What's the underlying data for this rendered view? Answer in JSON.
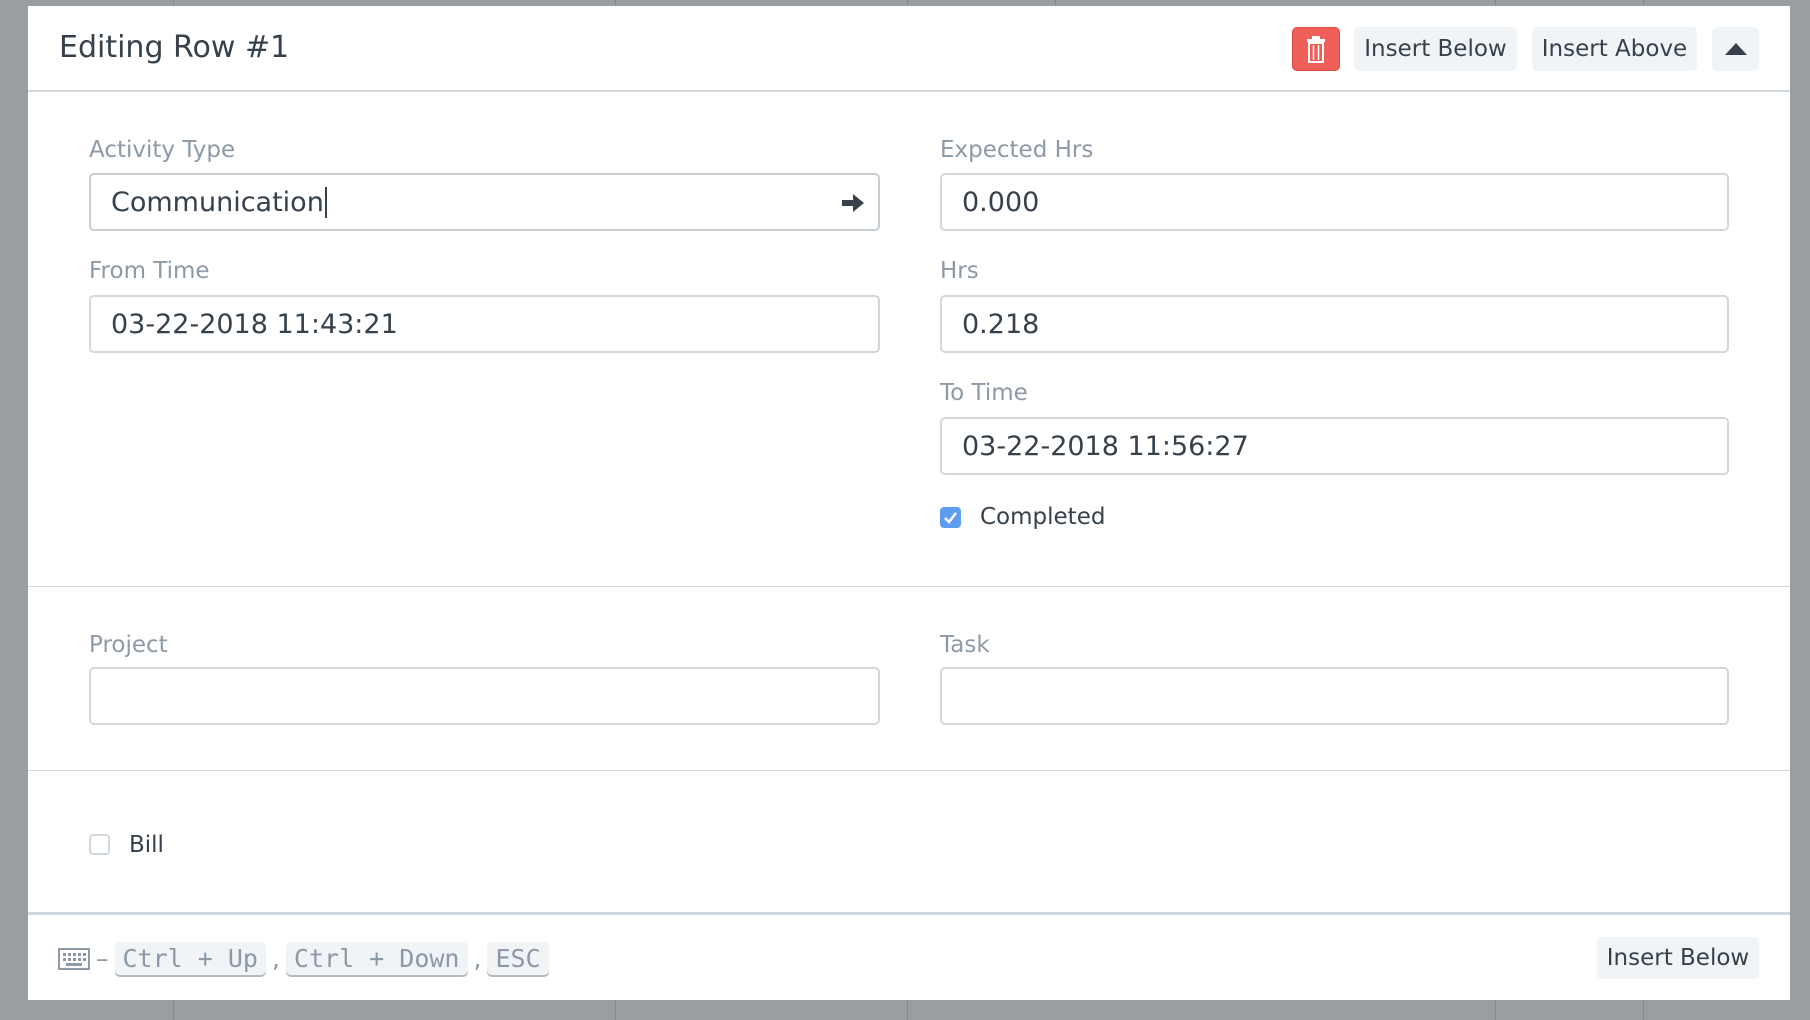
{
  "header": {
    "title": "Editing Row #1",
    "delete_icon": "trash-icon",
    "insert_below": "Insert Below",
    "insert_above": "Insert Above",
    "collapse_icon": "caret-up-icon"
  },
  "fields": {
    "activity_type": {
      "label": "Activity Type",
      "value": "Communication"
    },
    "expected_hrs": {
      "label": "Expected Hrs",
      "value": "0.000"
    },
    "from_time": {
      "label": "From Time",
      "value": "03-22-2018 11:43:21"
    },
    "hrs": {
      "label": "Hrs",
      "value": "0.218"
    },
    "to_time": {
      "label": "To Time",
      "value": "03-22-2018 11:56:27"
    },
    "completed": {
      "label": "Completed",
      "checked": true
    },
    "project": {
      "label": "Project",
      "value": ""
    },
    "task": {
      "label": "Task",
      "value": ""
    },
    "bill": {
      "label": "Bill",
      "checked": false
    }
  },
  "footer": {
    "keyboard_icon": "keyboard-icon",
    "dash": "–",
    "shortcuts": [
      "Ctrl + Up",
      "Ctrl + Down",
      "ESC"
    ],
    "sep": ",",
    "insert_below": "Insert Below"
  },
  "colors": {
    "danger": "#ef5f5a",
    "checkbox": "#5e9cf0"
  }
}
